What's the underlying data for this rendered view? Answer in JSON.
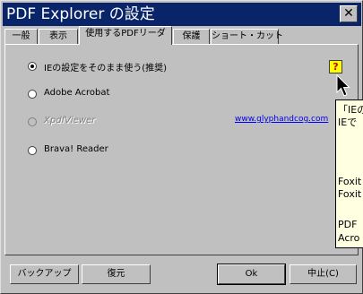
{
  "window": {
    "title": "PDF Explorer の設定",
    "close_glyph": "✕"
  },
  "tabs": [
    {
      "label": "一般"
    },
    {
      "label": "表示"
    },
    {
      "label": "使用するPDFリーダ",
      "active": true
    },
    {
      "label": "保護"
    },
    {
      "label": "ショート・カット"
    }
  ],
  "options": [
    {
      "label": "IEの設定をそのまま使う(推奨)",
      "selected": true,
      "enabled": true
    },
    {
      "label": "Adobe Acrobat",
      "selected": false,
      "enabled": true
    },
    {
      "label": "XpdfViewer",
      "selected": false,
      "enabled": false
    },
    {
      "label": "Brava! Reader",
      "selected": false,
      "enabled": true
    }
  ],
  "link": "www.glyphandcog.com",
  "help_icon": {
    "name": "help-icon",
    "glyph": "?"
  },
  "tooltip_lines": [
    "「IEの",
    "IEで",
    "Foxit",
    "Foxit",
    "PDF",
    "Acro"
  ],
  "buttons": {
    "backup": "バックアップ",
    "restore": "復元",
    "ok": "Ok",
    "cancel": "中止(C)"
  }
}
